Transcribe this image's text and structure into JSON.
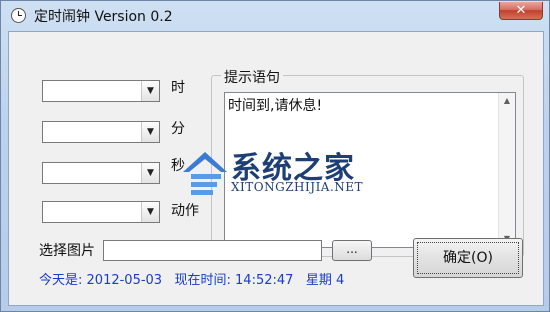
{
  "window": {
    "title": "定时闹钟 Version 0.2",
    "close_glyph": "✕"
  },
  "time_fields": [
    {
      "label": "时",
      "value": ""
    },
    {
      "label": "分",
      "value": ""
    },
    {
      "label": "秒",
      "value": ""
    },
    {
      "label": "动作",
      "value": ""
    }
  ],
  "message_group": {
    "legend": "提示语句",
    "text": "时间到,请休息!"
  },
  "image_select": {
    "label": "选择图片",
    "value": "",
    "browse_label": "..."
  },
  "ok_button": {
    "label": "确定(O)"
  },
  "status_bar": {
    "today_label": "今天是:",
    "date": "2012-05-03",
    "time_label": "现在时间:",
    "time": "14:52:47",
    "weekday": "星期 4"
  },
  "watermark": {
    "cn": "系统之家",
    "en": "XITONGZHIJIA.NET"
  },
  "colors": {
    "status_text": "#1a3cc8",
    "watermark": "#1e3f74",
    "close_button": "#c2412d"
  }
}
